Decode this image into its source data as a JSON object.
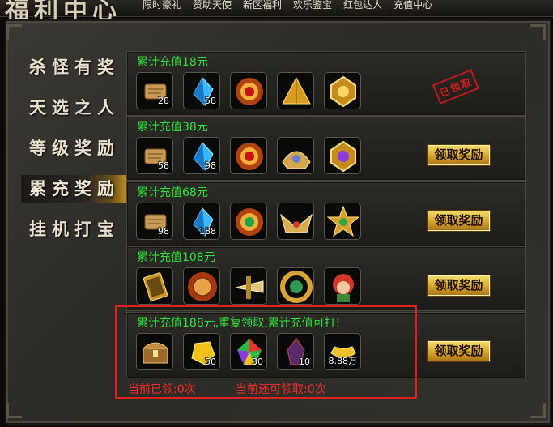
{
  "header": {
    "title": "福利中心",
    "tabs": [
      "限时豪礼",
      "赞助天使",
      "新区福利",
      "欢乐鉴宝",
      "红包达人",
      "充值中心"
    ]
  },
  "sidebar": {
    "items": [
      {
        "label": "杀怪有奖",
        "active": false
      },
      {
        "label": "天选之人",
        "active": false
      },
      {
        "label": "等级奖励",
        "active": false
      },
      {
        "label": "累充奖励",
        "active": true
      },
      {
        "label": "挂机打宝",
        "active": false
      }
    ]
  },
  "rewards": [
    {
      "title": "累计充值18元",
      "status": "已领取",
      "items": [
        {
          "icon": "scroll-icon",
          "qty": "28"
        },
        {
          "icon": "blue-crystal-icon",
          "qty": "58"
        },
        {
          "icon": "fire-red-gem-icon",
          "qty": ""
        },
        {
          "icon": "golden-pyramid-icon",
          "qty": ""
        },
        {
          "icon": "gold-medal-icon",
          "qty": ""
        }
      ]
    },
    {
      "title": "累计充值38元",
      "button": "领取奖励",
      "items": [
        {
          "icon": "scroll-icon",
          "qty": "58"
        },
        {
          "icon": "blue-crystal-icon",
          "qty": "98"
        },
        {
          "icon": "fire-red-gem-icon",
          "qty": ""
        },
        {
          "icon": "golden-shoulder-armor-icon",
          "qty": ""
        },
        {
          "icon": "purple-gem-gold-medal-icon",
          "qty": ""
        }
      ]
    },
    {
      "title": "累计充值68元",
      "button": "领取奖励",
      "items": [
        {
          "icon": "scroll-icon",
          "qty": "98"
        },
        {
          "icon": "blue-crystal-icon",
          "qty": "188"
        },
        {
          "icon": "fire-green-gem-icon",
          "qty": ""
        },
        {
          "icon": "winged-gold-crest-icon",
          "qty": ""
        },
        {
          "icon": "golden-star-medal-icon",
          "qty": ""
        }
      ]
    },
    {
      "title": "累计充值108元",
      "button": "领取奖励",
      "items": [
        {
          "icon": "golden-book-icon",
          "qty": ""
        },
        {
          "icon": "fire-medal-icon",
          "qty": ""
        },
        {
          "icon": "golden-weapon-icon",
          "qty": ""
        },
        {
          "icon": "green-gold-ring-icon",
          "qty": ""
        },
        {
          "icon": "red-hair-pet-icon",
          "qty": ""
        }
      ]
    },
    {
      "title": "累计充值188元,重复领取,累计充值可打!",
      "button": "领取奖励",
      "items": [
        {
          "icon": "treasure-chest-icon",
          "qty": ""
        },
        {
          "icon": "gold-nugget-icon",
          "qty": "50"
        },
        {
          "icon": "rainbow-gem-icon",
          "qty": "30"
        },
        {
          "icon": "dark-crystal-icon",
          "qty": "10"
        },
        {
          "icon": "gold-ingot-icon",
          "qty": "8.88万"
        }
      ]
    }
  ],
  "counter": {
    "claimed": "当前已领:0次",
    "remaining": "当前还可领取:0次"
  },
  "colors": {
    "title_green": "#2ee33a",
    "warning_red": "#ff2a2a",
    "button_gold": "#e6b43a"
  }
}
